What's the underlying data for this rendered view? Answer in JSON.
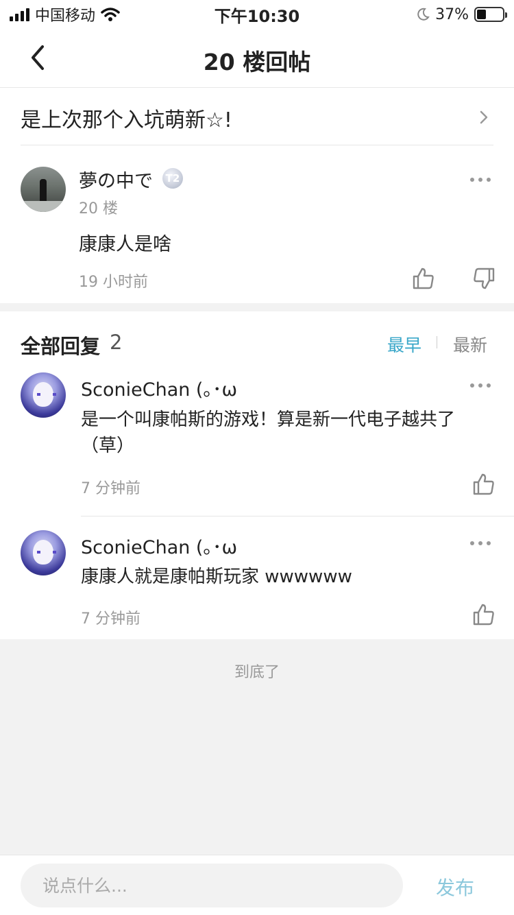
{
  "status_bar": {
    "carrier": "中国移动",
    "time": "下午10:30",
    "battery_level": "37%",
    "icons": [
      "signal-icon",
      "wifi-icon",
      "moon-icon",
      "battery-icon"
    ]
  },
  "nav": {
    "title": "20 楼回帖",
    "back_icon": "chevron-left-icon"
  },
  "thread": {
    "title": "是上次那个入坑萌新☆!"
  },
  "floor_post": {
    "username": "夢の中で",
    "badge_label": "T2",
    "floor_label": "20 楼",
    "content": "康康人是啥",
    "time": "19 小时前"
  },
  "replies": {
    "title": "全部回复",
    "count": "2",
    "sort_earliest": "最早",
    "sort_newest": "最新",
    "active_sort_color": "#3aa7c9",
    "items": [
      {
        "username": "SconieChan (｡･ω",
        "content": "是一个叫康帕斯的游戏！算是新一代电子越共了（草）",
        "time": "7 分钟前"
      },
      {
        "username": "SconieChan (｡･ω",
        "content": "康康人就是康帕斯玩家 wwwwww",
        "time": "7 分钟前"
      }
    ]
  },
  "end_text": "到底了",
  "composer": {
    "placeholder": "说点什么...",
    "publish_label": "发布",
    "publish_color": "#8cc8dc"
  }
}
